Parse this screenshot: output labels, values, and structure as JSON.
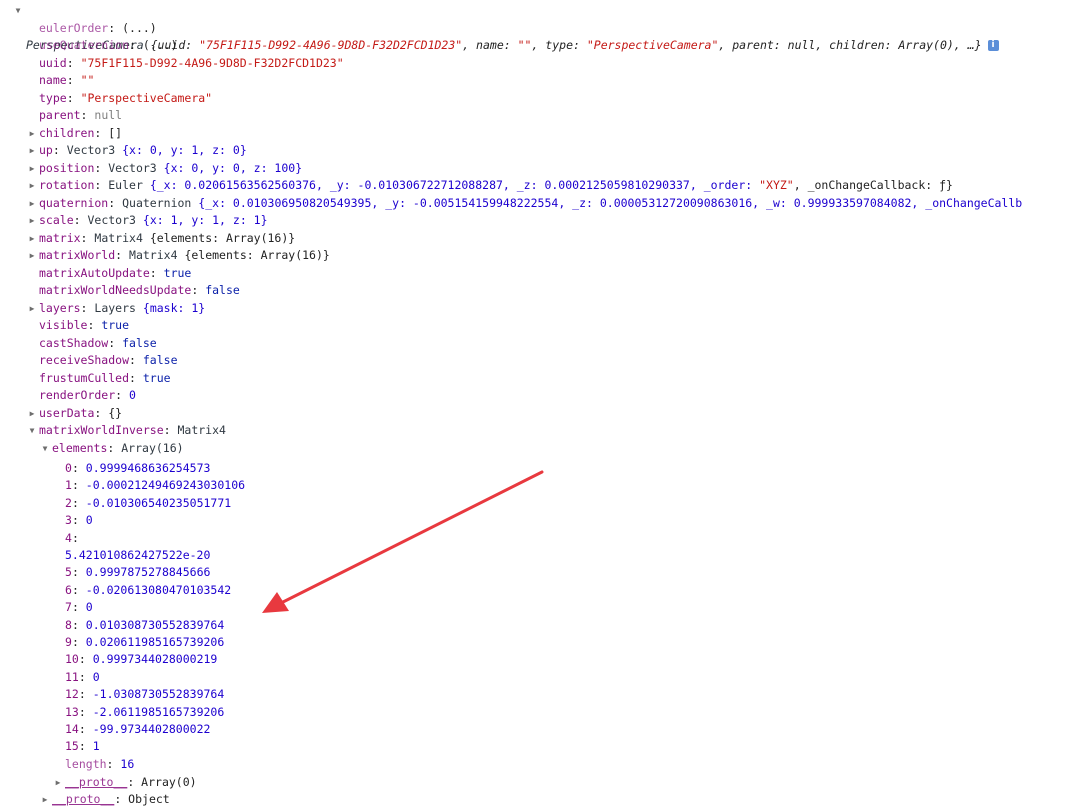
{
  "header": {
    "class_name": "PerspectiveCamera",
    "preview_open": " {uuid: ",
    "preview_uuid": "\"75F1F115-D992-4A96-9D8D-F32D2FCD1D23\"",
    "preview_mid1": ", name: ",
    "preview_name": "\"\"",
    "preview_mid2": ", type: ",
    "preview_type": "\"PerspectiveCamera\"",
    "preview_tail": ", parent: null, children: Array(0), …}",
    "info_label": "i"
  },
  "props": {
    "eulerOrder": {
      "key": "eulerOrder",
      "value": "(...)"
    },
    "useQuaternion": {
      "key": "useQuaternion",
      "value": "(...)"
    },
    "uuid": {
      "key": "uuid",
      "value": "\"75F1F115-D992-4A96-9D8D-F32D2FCD1D23\""
    },
    "name": {
      "key": "name",
      "value": "\"\""
    },
    "type": {
      "key": "type",
      "value": "\"PerspectiveCamera\""
    },
    "parent": {
      "key": "parent",
      "value": "null"
    },
    "children": {
      "key": "children",
      "value": "[]"
    },
    "up": {
      "key": "up",
      "cls": "Vector3",
      "value": "{x: 0, y: 1, z: 0}"
    },
    "position": {
      "key": "position",
      "cls": "Vector3",
      "value": "{x: 0, y: 0, z: 100}"
    },
    "rotation": {
      "key": "rotation",
      "cls": "Euler",
      "value_a": "{_x: 0.02061563562560376, _y: -0.010306722712088287, _z: 0.0002125059810290337, _order: ",
      "value_str": "\"XYZ\"",
      "value_b": ", _onChangeCallback: ƒ}"
    },
    "quaternion": {
      "key": "quaternion",
      "cls": "Quaternion",
      "value": "{_x: 0.010306950820549395, _y: -0.005154159948222554, _z: 0.00005312720090863016, _w: 0.999933597084082, _onChangeCallb"
    },
    "scale": {
      "key": "scale",
      "cls": "Vector3",
      "value": "{x: 1, y: 1, z: 1}"
    },
    "matrix": {
      "key": "matrix",
      "cls": "Matrix4",
      "value": "{elements: Array(16)}"
    },
    "matrixWorld": {
      "key": "matrixWorld",
      "cls": "Matrix4",
      "value": "{elements: Array(16)}"
    },
    "matrixAutoUpdate": {
      "key": "matrixAutoUpdate",
      "value": "true"
    },
    "matrixWorldNeedsUpdate": {
      "key": "matrixWorldNeedsUpdate",
      "value": "false"
    },
    "layers": {
      "key": "layers",
      "cls": "Layers",
      "value": "{mask: 1}"
    },
    "visible": {
      "key": "visible",
      "value": "true"
    },
    "castShadow": {
      "key": "castShadow",
      "value": "false"
    },
    "receiveShadow": {
      "key": "receiveShadow",
      "value": "false"
    },
    "frustumCulled": {
      "key": "frustumCulled",
      "value": "true"
    },
    "renderOrder": {
      "key": "renderOrder",
      "value": "0"
    },
    "userData": {
      "key": "userData",
      "value": "{}"
    },
    "matrixWorldInverse": {
      "key": "matrixWorldInverse",
      "cls": "Matrix4"
    },
    "elements": {
      "key": "elements",
      "cls": "Array(16)"
    }
  },
  "elements": [
    {
      "index": "0",
      "value": "0.9999468636254573"
    },
    {
      "index": "1",
      "value": "-0.00021249469243030106"
    },
    {
      "index": "2",
      "value": "-0.010306540235051771"
    },
    {
      "index": "3",
      "value": "0"
    },
    {
      "index": "4",
      "value": "",
      "wrap": "5.421010862427522e-20"
    },
    {
      "index": "5",
      "value": "0.9997875278845666"
    },
    {
      "index": "6",
      "value": "-0.020613080470103542"
    },
    {
      "index": "7",
      "value": "0"
    },
    {
      "index": "8",
      "value": "0.010308730552839764"
    },
    {
      "index": "9",
      "value": "0.020611985165739206"
    },
    {
      "index": "10",
      "value": "0.9997344028000219"
    },
    {
      "index": "11",
      "value": "0"
    },
    {
      "index": "12",
      "value": "-1.0308730552839764"
    },
    {
      "index": "13",
      "value": "-2.0611985165739206"
    },
    {
      "index": "14",
      "value": "-99.9734402800022"
    },
    {
      "index": "15",
      "value": "1"
    }
  ],
  "length": {
    "key": "length",
    "value": "16"
  },
  "array_proto": {
    "key": "__proto__",
    "value": "Array(0)"
  },
  "object_proto": {
    "key": "__proto__",
    "value": "Object"
  },
  "colors": {
    "key": "#881280",
    "string": "#c41a16",
    "number": "#1c00cf",
    "keyword": "#0d22aa",
    "arrow": "#e8393f",
    "info_badge": "#5b8ed8"
  },
  "icons": {
    "expanded": "triangle-down-icon",
    "collapsed": "triangle-right-icon",
    "info": "info-icon",
    "annotation": "red-arrow"
  }
}
